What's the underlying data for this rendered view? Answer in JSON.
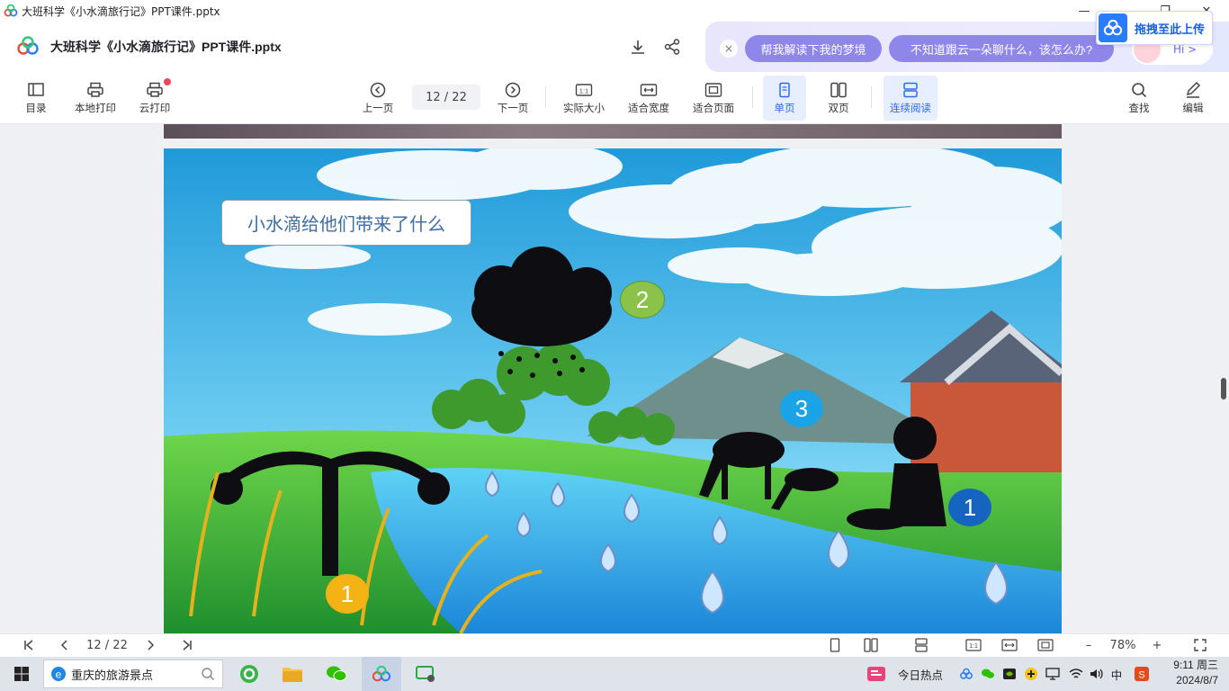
{
  "window": {
    "title": "大班科学《小水滴旅行记》PPT课件.pptx",
    "controls": [
      "—",
      "❐",
      "✕"
    ]
  },
  "header": {
    "file_name": "大班科学《小水滴旅行记》PPT课件.pptx",
    "icons": [
      "download-icon",
      "share-icon"
    ]
  },
  "ai_panel": {
    "close": "×",
    "chips": [
      "帮我解读下我的梦境",
      "不知道跟云一朵聊什么，该怎么办?"
    ],
    "avatar_text": "Hi >",
    "upload_label": "拖拽至此上传"
  },
  "toolbar": {
    "toc": "目录",
    "local_print": "本地打印",
    "cloud_print": "云打印",
    "prev": "上一页",
    "page_current": "12",
    "page_total": "22",
    "page_display": "12 / 22",
    "next": "下一页",
    "actual_size": "实际大小",
    "fit_width": "适合宽度",
    "fit_page": "适合页面",
    "single_page": "单页",
    "double_page": "双页",
    "continuous": "连续阅读",
    "find": "查找",
    "edit": "编辑",
    "actual_size_glyph": "1:1"
  },
  "slide": {
    "title": "小水滴给他们带来了什么",
    "badges": [
      {
        "label": "1",
        "color": "#f3b315"
      },
      {
        "label": "2",
        "color": "#8bc34a"
      },
      {
        "label": "3",
        "color": "#1aa3e6"
      },
      {
        "label": "1",
        "color": "#1565c0"
      }
    ],
    "colors": {
      "sky_top": "#2fa7e0",
      "sky_bottom": "#8fd8f5",
      "grass": "#3bbf3b",
      "river": "#3aa0e8"
    }
  },
  "statusbar": {
    "page_display": "12 / 22",
    "zoom": "78%",
    "minus": "–",
    "plus": "+",
    "actual_glyph": "1:1"
  },
  "taskbar": {
    "search_text": "重庆的旅游景点",
    "hot_news": "今日热点",
    "ime": "中",
    "time": "9:11 周三",
    "date": "2024/8/7"
  }
}
